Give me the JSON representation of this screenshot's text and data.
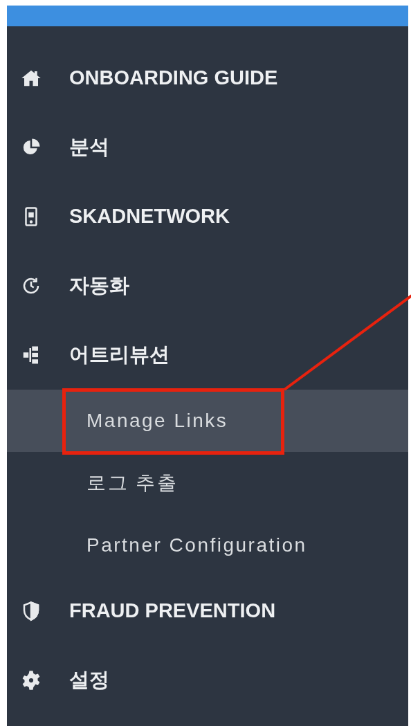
{
  "sidebar": {
    "items": [
      {
        "label": "ONBOARDING GUIDE"
      },
      {
        "label": "분석"
      },
      {
        "label": "SKADNETWORK"
      },
      {
        "label": "자동화"
      },
      {
        "label": "어트리뷰션",
        "children": [
          {
            "label": "Manage Links",
            "selected": true,
            "annotated": true
          },
          {
            "label": "로그 추출",
            "selected": false,
            "annotated": false
          },
          {
            "label": "Partner Configuration",
            "selected": false,
            "annotated": false
          }
        ]
      },
      {
        "label": "FRAUD PREVENTION"
      },
      {
        "label": "설정"
      }
    ]
  }
}
